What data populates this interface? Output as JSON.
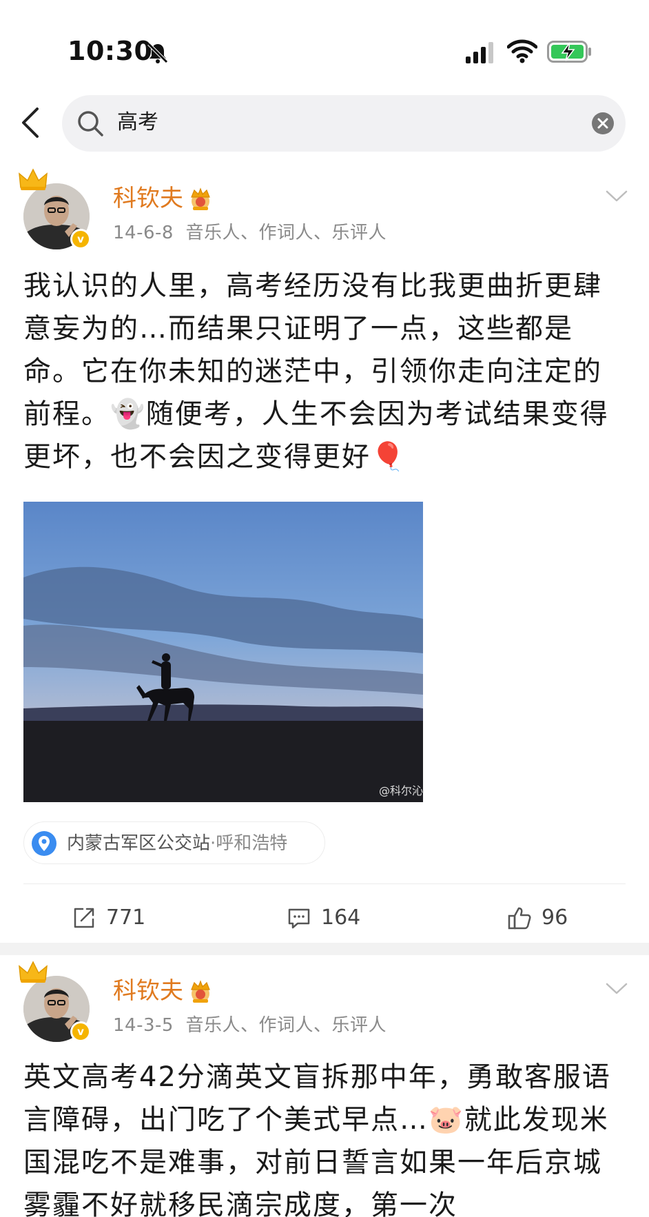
{
  "status_bar": {
    "time": "10:30"
  },
  "search": {
    "query": "高考"
  },
  "posts": [
    {
      "username": "科钦夫",
      "date": "14-6-8",
      "tags": "音乐人、作词人、乐评人",
      "text": "我认识的人里，高考经历没有比我更曲折更肆意妄为的…而结果只证明了一点，这些都是命。它在你未知的迷茫中，引领你走向注定的前程。👻随便考，人生不会因为考试结果变得更坏，也不会因之变得更好🎈",
      "image_watermark": "@科尔沁",
      "location": {
        "place": "内蒙古军区公交站",
        "city": "·呼和浩特"
      },
      "actions": {
        "reposts": "771",
        "comments": "164",
        "likes": "96"
      }
    },
    {
      "username": "科钦夫",
      "date": "14-3-5",
      "tags": "音乐人、作词人、乐评人",
      "text": "英文高考42分滴英文盲拆那中年，勇敢客服语言障碍，出门吃了个美式早点…🐷就此发现米国混吃不是难事，对前日誓言如果一年后京城雾霾不好就移民滴宗成度，第一次"
    }
  ],
  "colors": {
    "username": "#e07a1f",
    "verified": "#f5b400",
    "location_pin": "#3a8cf0",
    "meta": "#8a8a8a"
  },
  "icons": [
    "bell-off-icon",
    "signal-icon",
    "wifi-icon",
    "battery-charging-icon",
    "back-icon",
    "search-icon",
    "clear-icon",
    "crown-icon",
    "vip-crown-icon",
    "chevron-down-icon",
    "location-pin-icon",
    "repost-icon",
    "comment-icon",
    "like-icon"
  ]
}
